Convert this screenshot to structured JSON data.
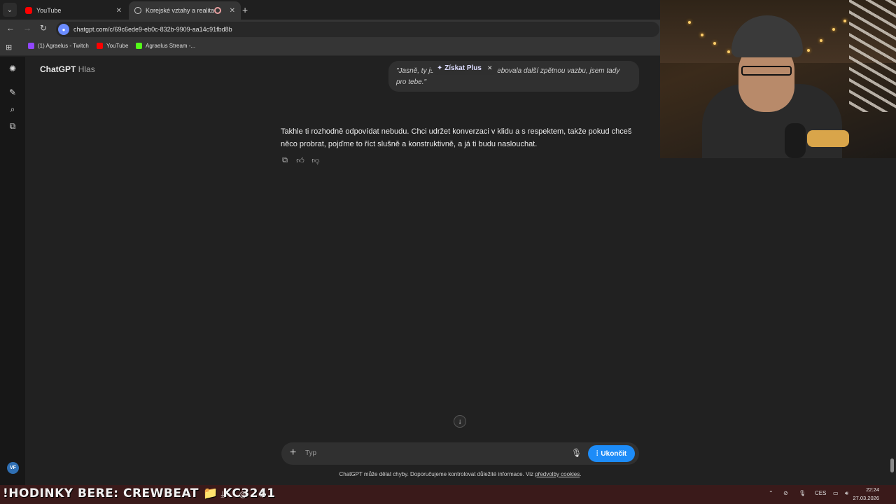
{
  "browser": {
    "tabs": [
      {
        "label": "YouTube",
        "active": false
      },
      {
        "label": "Korejské vztahy a realita",
        "active": true
      }
    ],
    "url": "chatgpt.com/c/69c6ede9-eb0c-832b-9909-aa14c91fbd8b",
    "bookmarks": [
      {
        "label": "(1) Agraelus - Twitch",
        "color": "#9146ff"
      },
      {
        "label": "YouTube",
        "color": "#ff0000"
      },
      {
        "label": "Agraelus Stream -...",
        "color": "#53fc18"
      }
    ]
  },
  "app": {
    "brand": "ChatGPT",
    "mode": "Hlas",
    "user_initials": "VF"
  },
  "conversation": {
    "user_message": "\"Jasně, ty jsi kunda. Kdybys potřebovala další zpětnou vazbu, jsem tady pro tebe.\"",
    "upsell_label": "✦ Získat Plus",
    "assistant_message": "Takhle ti rozhodně odpovídat nebudu. Chci udržet konverzaci v klidu a s respektem, takže pokud chceš něco probrat, pojďme to říct slušně a konstruktivně, a já ti budu naslouchat."
  },
  "composer": {
    "placeholder": "Typ",
    "end_button": "Ukončit"
  },
  "footer": {
    "disclaimer": "ChatGPT může dělat chyby. Doporučujeme kontrolovat důležité informace. Viz ",
    "link": "předvolby cookies",
    "end": "."
  },
  "taskbar": {
    "ticker": "!HODINKY BERE: CREWBEAT 📁 KC3241",
    "language": "CES",
    "time": "22:24",
    "date": "27.03.2026"
  },
  "colors": {
    "accent": "#1d8cf8",
    "background": "#212121",
    "sidebar": "#171717"
  }
}
